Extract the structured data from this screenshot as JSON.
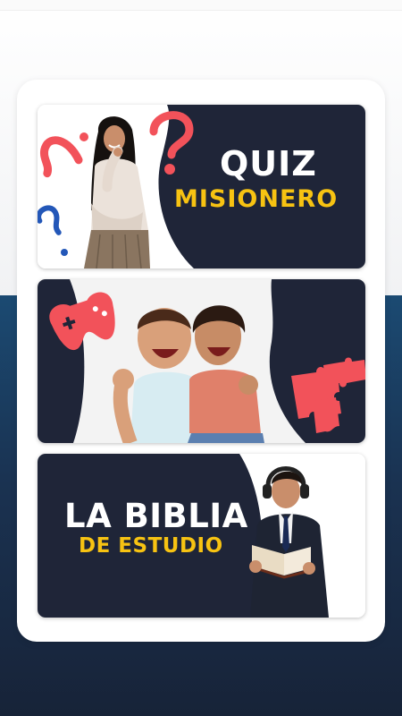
{
  "cards": [
    {
      "id": "quiz-misionero",
      "title_line1": "QUIZ",
      "title_line2": "MISIONERO",
      "illustration": "woman-thinking",
      "icons": [
        "question-mark-icon"
      ]
    },
    {
      "id": "games",
      "title_line1": "",
      "title_line2": "",
      "illustration": "two-kids-celebrating",
      "icons": [
        "gamepad-icon",
        "puzzle-icon"
      ]
    },
    {
      "id": "la-biblia-de-estudio",
      "title_line1": "LA BIBLIA",
      "title_line2": "DE ESTUDIO",
      "illustration": "man-reading-book",
      "icons": []
    }
  ],
  "colors": {
    "navy": "#1f2538",
    "accent_red": "#f2525a",
    "accent_blue": "#2357b8",
    "yellow": "#f7c312"
  }
}
